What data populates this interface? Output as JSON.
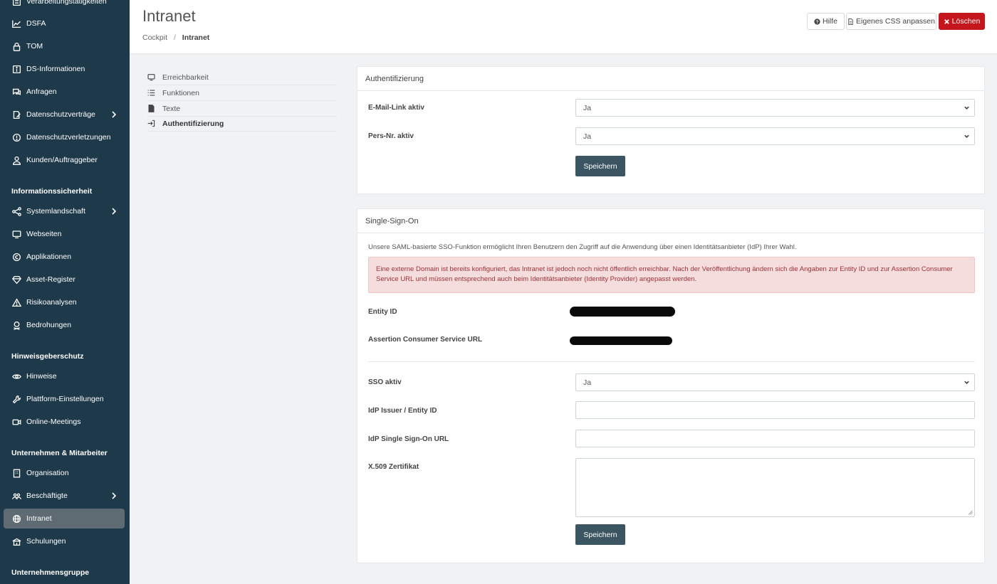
{
  "sidebar": {
    "items": [
      {
        "label": "Verarbeitungstätigkeiten",
        "icon": "list-icon"
      },
      {
        "label": "DSFA",
        "icon": "chart-line-icon"
      },
      {
        "label": "TOM",
        "icon": "lock-icon"
      },
      {
        "label": "DS-Informationen",
        "icon": "info-box-icon"
      },
      {
        "label": "Anfragen",
        "icon": "comments-icon"
      },
      {
        "label": "Datenschutzverträge",
        "icon": "contract-edit-icon"
      },
      {
        "label": "Datenschutzverletzungen",
        "icon": "alert-circle-icon"
      },
      {
        "label": "Kunden/Auftraggeber",
        "icon": "user-icon"
      },
      {
        "label": "Systemlandschaft",
        "icon": "network-icon"
      },
      {
        "label": "Webseiten",
        "icon": "monitor-icon"
      },
      {
        "label": "Applikationen",
        "icon": "copyright-icon"
      },
      {
        "label": "Asset-Register",
        "icon": "diamond-icon"
      },
      {
        "label": "Risikoanalysen",
        "icon": "warning-triangle-icon"
      },
      {
        "label": "Bedrohungen",
        "icon": "skull-icon"
      },
      {
        "label": "Hinweise",
        "icon": "eye-slash-icon"
      },
      {
        "label": "Plattform-Einstellungen",
        "icon": "wrench-icon"
      },
      {
        "label": "Online-Meetings",
        "icon": "video-icon"
      },
      {
        "label": "Organisation",
        "icon": "building-icon"
      },
      {
        "label": "Beschäftigte",
        "icon": "users-icon"
      },
      {
        "label": "Intranet",
        "icon": "globe-icon"
      },
      {
        "label": "Schulungen",
        "icon": "school-icon"
      }
    ],
    "sections": {
      "infosec": "Informationssicherheit",
      "whistle": "Hinweisgeberschutz",
      "company": "Unternehmen & Mitarbeiter",
      "group": "Unternehmensgruppe"
    }
  },
  "header": {
    "title": "Intranet",
    "breadcrumb": {
      "root": "Cockpit",
      "sep": "/",
      "current": "Intranet"
    },
    "buttons": {
      "help": "Hilfe",
      "css": "Eigenes CSS anpassen",
      "delete": "Löschen"
    }
  },
  "subnav": [
    {
      "label": "Erreichbarkeit",
      "icon": "monitor-icon"
    },
    {
      "label": "Funktionen",
      "icon": "list-icon"
    },
    {
      "label": "Texte",
      "icon": "file-icon"
    },
    {
      "label": "Authentifizierung",
      "icon": "sign-in-icon"
    }
  ],
  "auth": {
    "title": "Authentifizierung",
    "email_label": "E-Mail-Link aktiv",
    "email_value": "Ja",
    "persnr_label": "Pers-Nr. aktiv",
    "persnr_value": "Ja",
    "save": "Speichern"
  },
  "sso": {
    "title": "Single-Sign-On",
    "description": "Unsere SAML-basierte SSO-Funktion ermöglicht Ihren Benutzern den Zugriff auf die Anwendung über einen Identitätsanbieter (IdP) Ihrer Wahl.",
    "alert": "Eine externe Domain ist bereits konfiguriert, das Intranet ist jedoch noch nicht öffentlich erreichbar. Nach der Veröffentlichung ändern sich die Angaben zur Entity ID und zur Assertion Consumer Service URL und müssen entsprechend auch beim Identitätsanbieter (Identity Provider) angepasst werden.",
    "entity_id_label": "Entity ID",
    "acs_label": "Assertion Consumer Service URL",
    "active_label": "SSO aktiv",
    "active_value": "Ja",
    "issuer_label": "IdP Issuer / Entity ID",
    "issuer_value": "",
    "sso_url_label": "IdP Single Sign-On URL",
    "sso_url_value": "",
    "cert_label": "X.509 Zertifikat",
    "cert_value": "",
    "save": "Speichern"
  },
  "colors": {
    "sidebar_bg": "#1e3a4a",
    "active_item": "#5f6b72",
    "delete_button": "#c4161c",
    "save_button": "#3c5562",
    "alert_bg": "#f5dcdd",
    "alert_text": "#9a3236"
  }
}
